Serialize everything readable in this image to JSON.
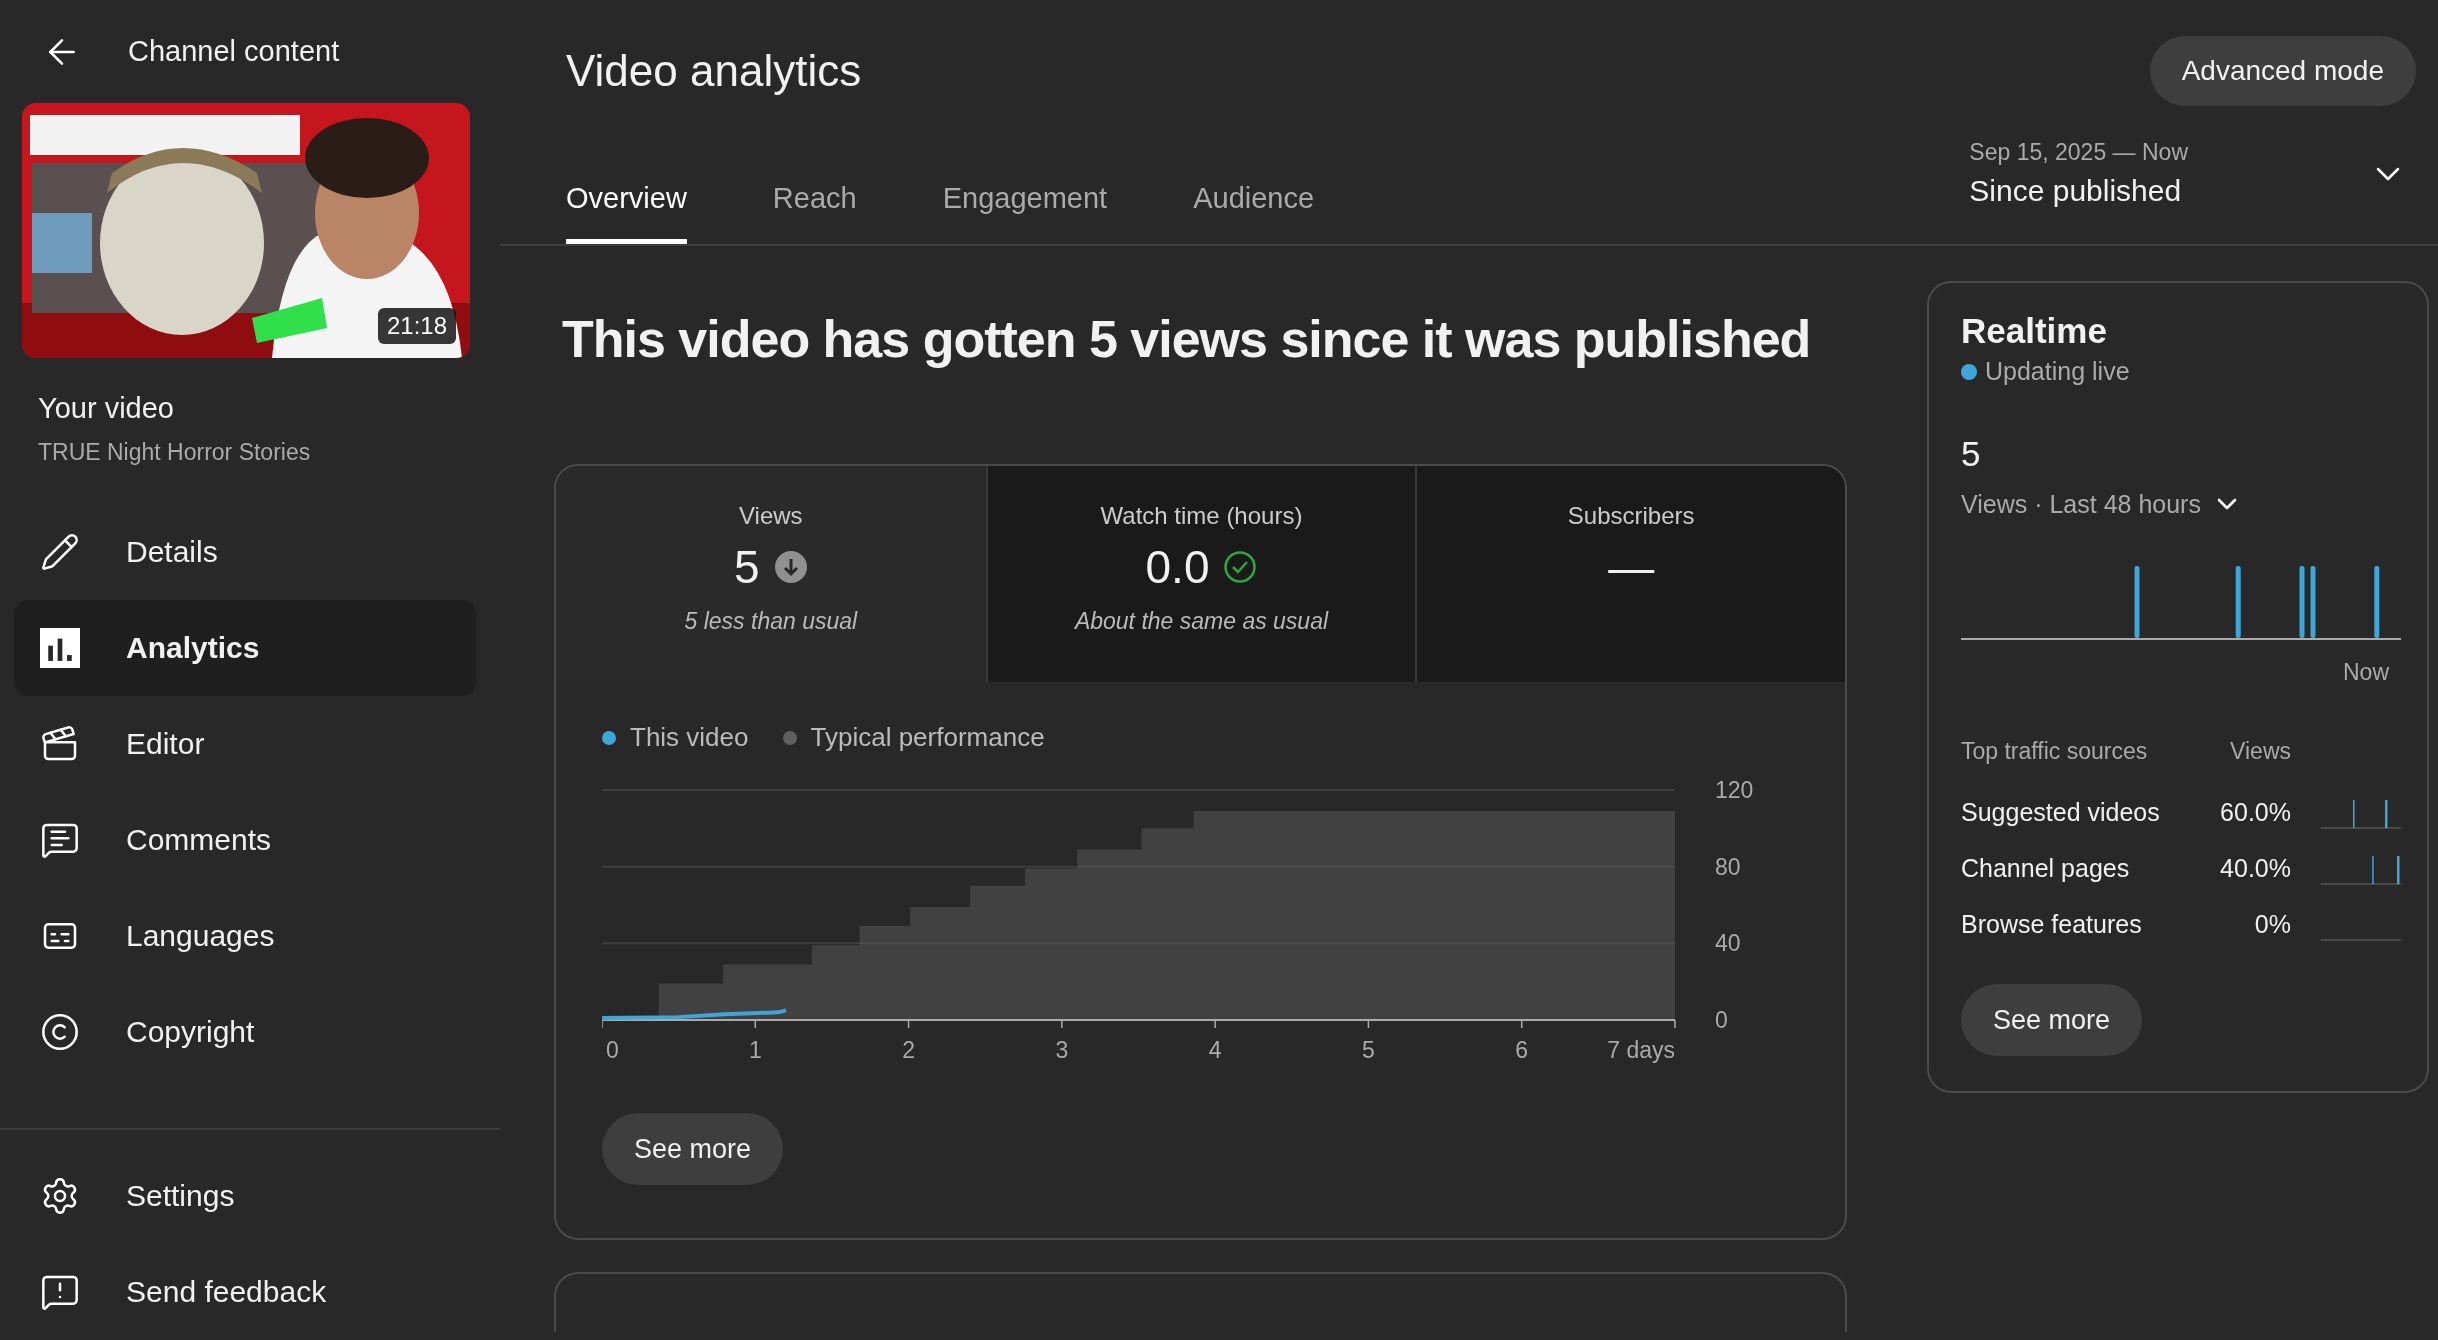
{
  "sidebar": {
    "back_label": "Channel content",
    "thumbnail": {
      "kind": "picture",
      "duration": "21:18"
    },
    "video_label": "Your video",
    "video_title": "TRUE Night Horror Stories",
    "nav_items": [
      {
        "label": "Details",
        "selected": false
      },
      {
        "label": "Analytics",
        "selected": true
      },
      {
        "label": "Editor",
        "selected": false
      },
      {
        "label": "Comments",
        "selected": false
      },
      {
        "label": "Languages",
        "selected": false
      },
      {
        "label": "Copyright",
        "selected": false
      }
    ],
    "footer_items": [
      {
        "label": "Settings"
      },
      {
        "label": "Send feedback"
      }
    ]
  },
  "header": {
    "title": "Video analytics",
    "advanced_button": "Advanced mode",
    "tabs": [
      {
        "label": "Overview",
        "selected": true
      },
      {
        "label": "Reach",
        "selected": false
      },
      {
        "label": "Engagement",
        "selected": false
      },
      {
        "label": "Audience",
        "selected": false
      }
    ],
    "date_range": {
      "dates": "Sep 15, 2025 — Now",
      "label": "Since published"
    }
  },
  "headline": "This video has gotten 5 views since it was published",
  "overview_card": {
    "metrics": [
      {
        "label": "Views",
        "value": "5",
        "kind": "below",
        "note": "5 less than usual",
        "selected": true
      },
      {
        "label": "Watch time (hours)",
        "value": "0.0",
        "kind": "typical",
        "note": "About the same as usual",
        "selected": false
      },
      {
        "label": "Subscribers",
        "value": "—",
        "kind": "plain",
        "selected": false
      }
    ],
    "chart_data": {
      "type": "line",
      "xlim": [
        0,
        7
      ],
      "ylim": [
        0,
        120
      ],
      "xticks": [
        0,
        1,
        2,
        3,
        4,
        5,
        6,
        {
          "value": 7,
          "label": "7 days"
        }
      ],
      "yticks": [
        0,
        40,
        80,
        120
      ],
      "series": [
        {
          "name": "This video",
          "color": "#3ea6d8",
          "x": [
            0,
            0.5,
            0.8,
            1.15,
            1.2
          ],
          "values": [
            1,
            1.5,
            3,
            4,
            5
          ]
        },
        {
          "name": "Typical performance",
          "type": "area",
          "color": "#606060",
          "x": [
            0,
            0.37,
            0.79,
            1.37,
            1.68,
            2.01,
            2.4,
            2.76,
            3.1,
            3.52,
            3.86,
            7
          ],
          "values": [
            2,
            19,
            29,
            39,
            49,
            59,
            70,
            79,
            89,
            100,
            109,
            109
          ]
        }
      ]
    },
    "see_more": "See more"
  },
  "realtime": {
    "title": "Realtime",
    "status": "Updating live",
    "value": "5",
    "metric_label": "Views · Last 48 hours",
    "axis_label": "Now",
    "traffic_header": {
      "source": "Top traffic sources",
      "views": "Views"
    },
    "traffic_sources": [
      {
        "name": "Suggested videos",
        "share": "60.0%"
      },
      {
        "name": "Channel pages",
        "share": "40.0%"
      },
      {
        "name": "Browse features",
        "share": "0%"
      }
    ],
    "see_more": "See more"
  }
}
